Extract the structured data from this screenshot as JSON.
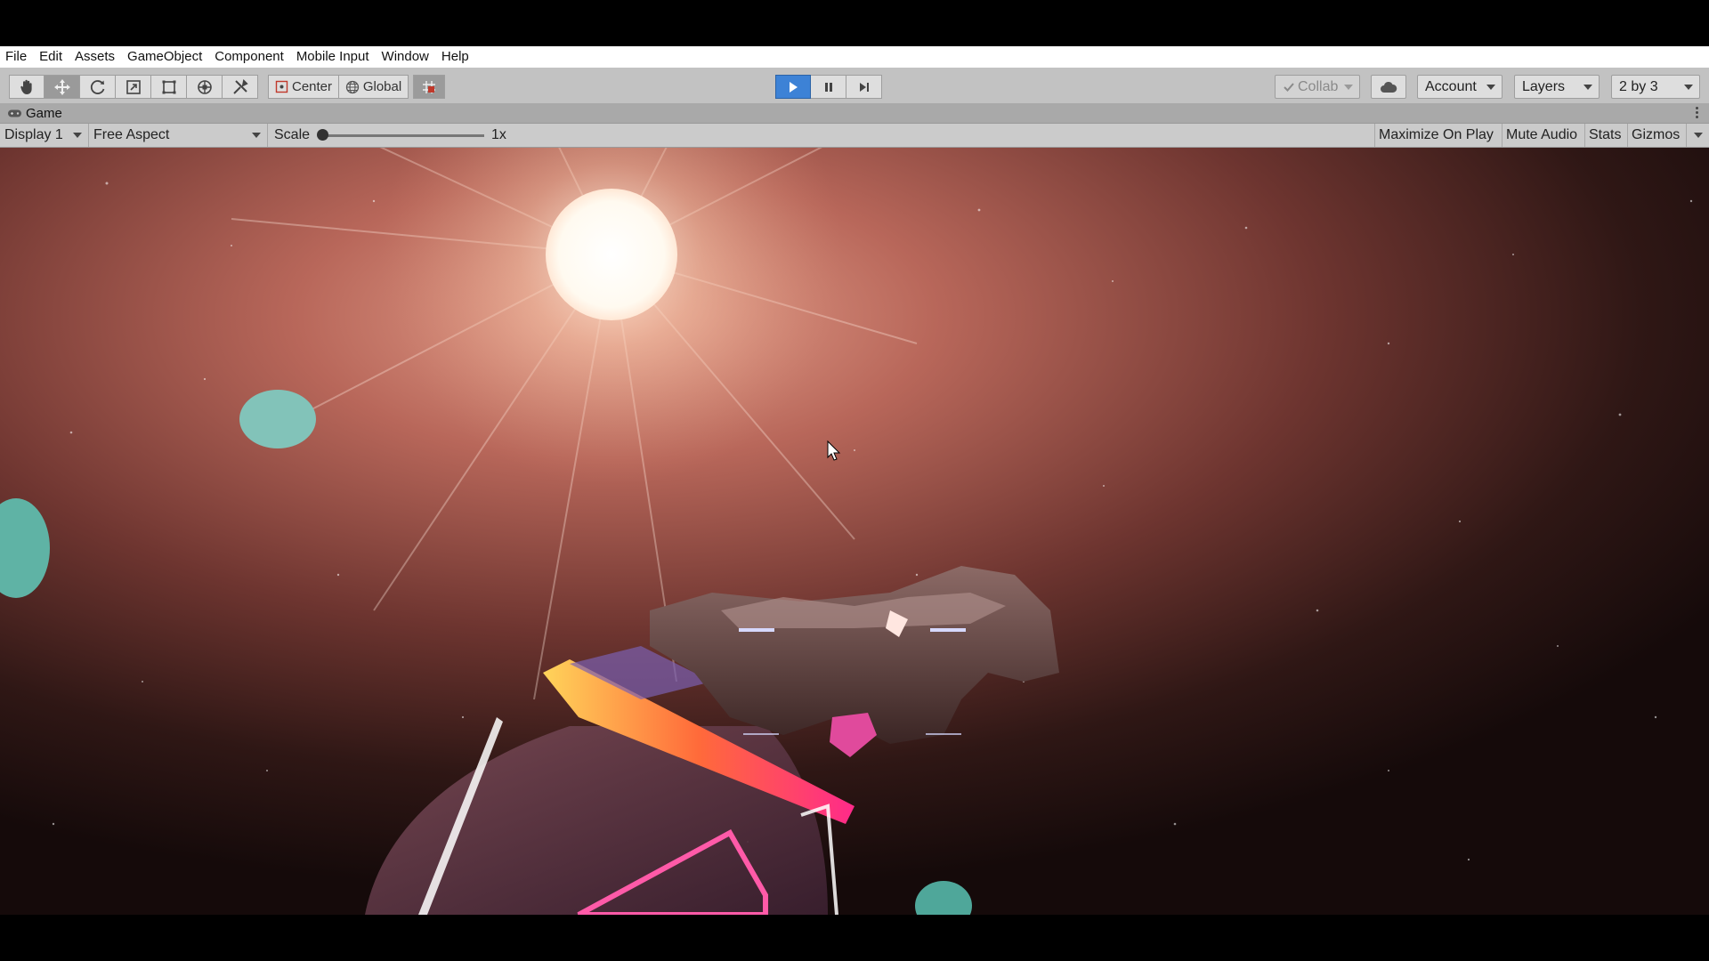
{
  "menu": [
    "File",
    "Edit",
    "Assets",
    "GameObject",
    "Component",
    "Mobile Input",
    "Window",
    "Help"
  ],
  "toolbar": {
    "tools": [
      {
        "name": "hand-tool",
        "icon": "hand-icon"
      },
      {
        "name": "move-tool",
        "icon": "move-icon"
      },
      {
        "name": "rotate-tool",
        "icon": "rotate-icon"
      },
      {
        "name": "scale-tool",
        "icon": "scale-icon"
      },
      {
        "name": "rect-tool",
        "icon": "rect-icon"
      },
      {
        "name": "transform-tool",
        "icon": "transform-icon"
      },
      {
        "name": "custom-tool",
        "icon": "custom-tool-icon"
      }
    ],
    "pivot_label": "Center",
    "space_label": "Global",
    "collab_label": "Collab",
    "account_label": "Account",
    "layers_label": "Layers",
    "layout_label": "2 by 3",
    "accent_color": "#3d82d6"
  },
  "game_tab": {
    "title": "Game"
  },
  "game_view": {
    "display": "Display 1",
    "aspect": "Free Aspect",
    "scale_label": "Scale",
    "scale_value": "1x",
    "maximize_label": "Maximize On Play",
    "mute_label": "Mute Audio",
    "stats_label": "Stats",
    "gizmos_label": "Gizmos"
  },
  "scene": {
    "sky_color": "#2a1413",
    "nebula_color": "#c0675a",
    "sun_color": "#fffaf2",
    "planet_color": "#7fc1b7"
  }
}
